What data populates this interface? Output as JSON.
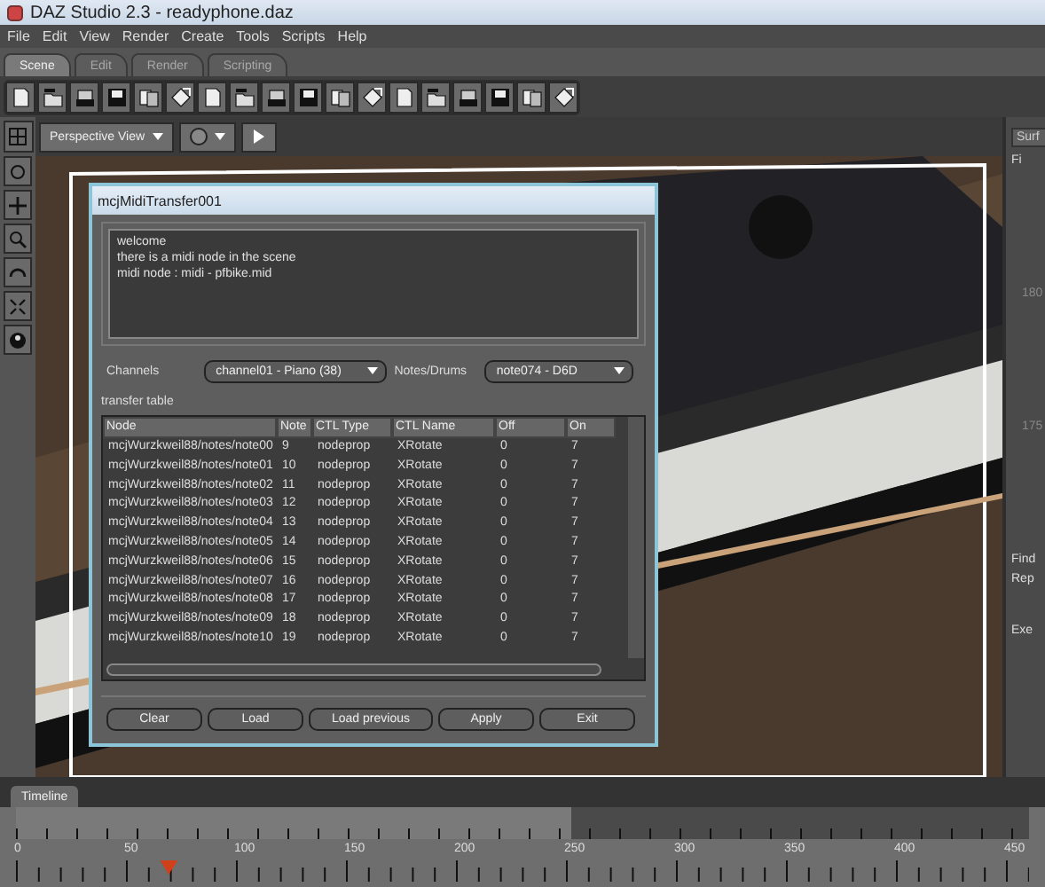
{
  "window": {
    "title": "DAZ Studio 2.3 - readyphone.daz"
  },
  "menu": [
    "File",
    "Edit",
    "View",
    "Render",
    "Create",
    "Tools",
    "Scripts",
    "Help"
  ],
  "tabs": [
    {
      "label": "Scene",
      "selected": true
    },
    {
      "label": "Edit",
      "selected": false
    },
    {
      "label": "Render",
      "selected": false
    },
    {
      "label": "Scripting",
      "selected": false
    }
  ],
  "viewport": {
    "camera": "Perspective View"
  },
  "dialog": {
    "title": "mcjMidiTransfer001",
    "log": [
      "welcome",
      "there is a midi node in the scene",
      "midi node : midi - pfbike.mid"
    ],
    "channels_label": "Channels",
    "channel": "channel01 - Piano (38)",
    "notes_label": "Notes/Drums",
    "note": "note074 - D6D",
    "group_label": "transfer table",
    "columns": [
      "Node",
      "Note",
      "CTL Type",
      "CTL Name",
      "Off",
      "On"
    ],
    "rows": [
      [
        "mcjWurzkweil88/notes/note00",
        "9",
        "nodeprop",
        "XRotate",
        "0",
        "7"
      ],
      [
        "mcjWurzkweil88/notes/note01",
        "10",
        "nodeprop",
        "XRotate",
        "0",
        "7"
      ],
      [
        "mcjWurzkweil88/notes/note02",
        "11",
        "nodeprop",
        "XRotate",
        "0",
        "7"
      ],
      [
        "mcjWurzkweil88/notes/note03",
        "12",
        "nodeprop",
        "XRotate",
        "0",
        "7"
      ],
      [
        "mcjWurzkweil88/notes/note04",
        "13",
        "nodeprop",
        "XRotate",
        "0",
        "7"
      ],
      [
        "mcjWurzkweil88/notes/note05",
        "14",
        "nodeprop",
        "XRotate",
        "0",
        "7"
      ],
      [
        "mcjWurzkweil88/notes/note06",
        "15",
        "nodeprop",
        "XRotate",
        "0",
        "7"
      ],
      [
        "mcjWurzkweil88/notes/note07",
        "16",
        "nodeprop",
        "XRotate",
        "0",
        "7"
      ],
      [
        "mcjWurzkweil88/notes/note08",
        "17",
        "nodeprop",
        "XRotate",
        "0",
        "7"
      ],
      [
        "mcjWurzkweil88/notes/note09",
        "18",
        "nodeprop",
        "XRotate",
        "0",
        "7"
      ],
      [
        "mcjWurzkweil88/notes/note10",
        "19",
        "nodeprop",
        "XRotate",
        "0",
        "7"
      ]
    ],
    "buttons": [
      "Clear",
      "Load",
      "Load previous",
      "Apply",
      "Exit"
    ]
  },
  "side_panel": {
    "tab": "Surf",
    "tab2": "Fi",
    "values": [
      "180",
      "175"
    ],
    "find": "Find",
    "replace": "Rep",
    "exec": "Exe"
  },
  "timeline": {
    "tab": "Timeline",
    "labels": [
      "0",
      "50",
      "100",
      "150",
      "200",
      "250",
      "300",
      "350",
      "400",
      "450"
    ]
  }
}
